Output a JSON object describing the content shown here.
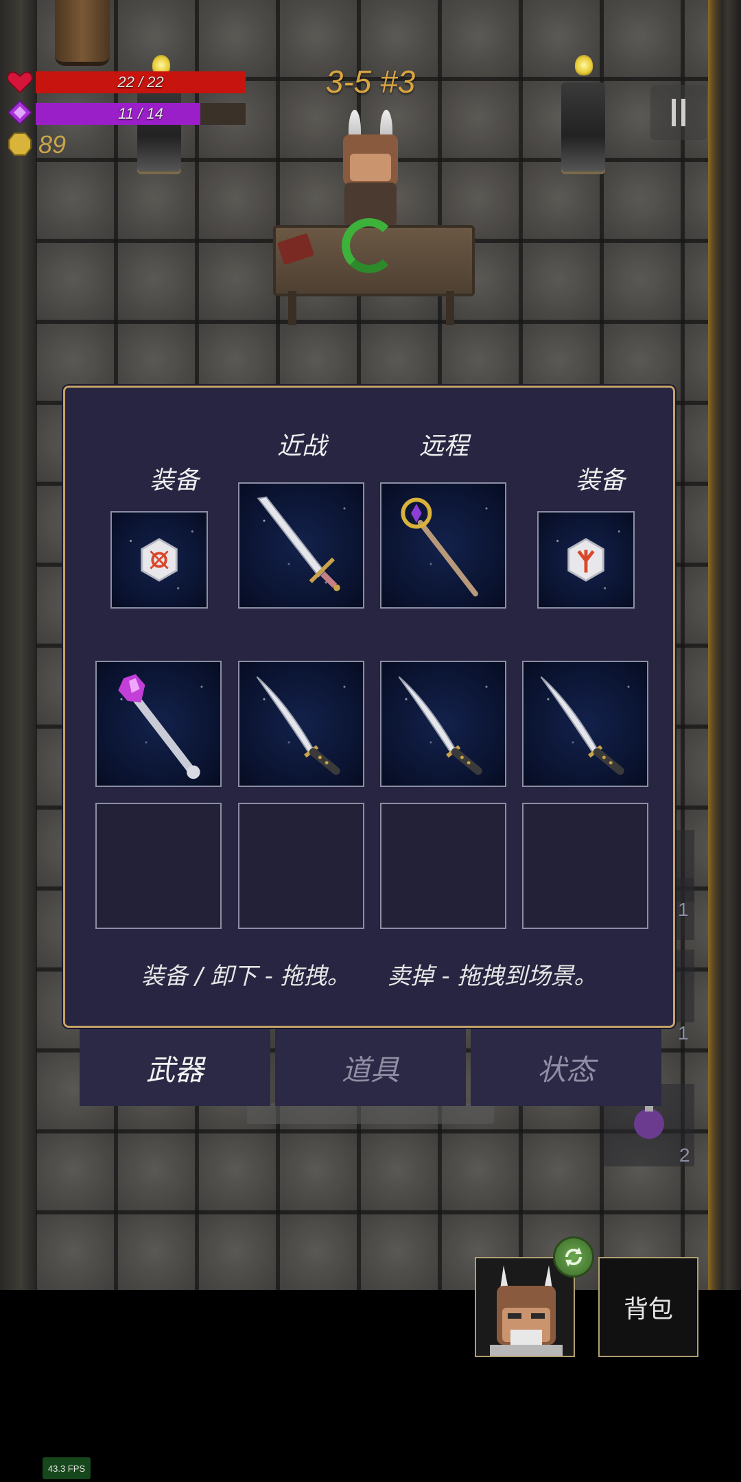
{
  "hud": {
    "hp_text": "22 / 22",
    "hp_fraction": 1.0,
    "mp_text": "11 / 14",
    "mp_fraction": 0.7857,
    "gold": "89",
    "level": "3-5 #3",
    "colors": {
      "hp": "#c8140e",
      "mp": "#9b1fc9",
      "gold": "#c9a54a",
      "level": "#d9a441"
    }
  },
  "background_counts": [
    "1",
    "1",
    "2"
  ],
  "inventory": {
    "labels": {
      "melee": "近战",
      "ranged": "远程",
      "equip_left": "装备",
      "equip_right": "装备"
    },
    "equipped": [
      {
        "slot": "equip-left",
        "item": "rune-stone-red-icon"
      },
      {
        "slot": "melee",
        "item": "longsword-icon"
      },
      {
        "slot": "ranged",
        "item": "golden-staff-icon"
      },
      {
        "slot": "equip-right",
        "item": "rune-stone-red-icon"
      }
    ],
    "backpack_row1": [
      "crystal-mace-icon",
      "katana-icon",
      "katana-icon",
      "katana-icon"
    ],
    "backpack_row2": [
      "",
      "",
      "",
      ""
    ],
    "hint": "装备 / 卸下 - 拖拽。     卖掉 - 拖拽到场景。"
  },
  "tabs": [
    {
      "label": "武器",
      "active": true
    },
    {
      "label": "道具",
      "active": false
    },
    {
      "label": "状态",
      "active": false
    }
  ],
  "actions": {
    "backpack": "背包"
  },
  "fps": "43.3 FPS"
}
